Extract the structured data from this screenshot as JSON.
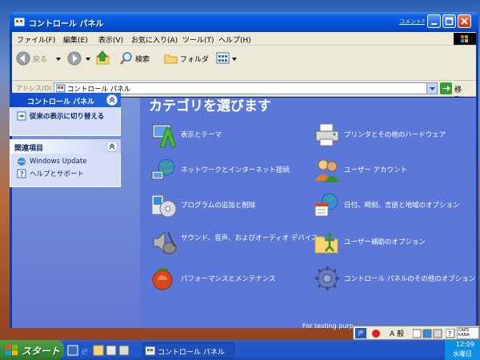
{
  "window": {
    "title": "コントロール パネル",
    "comment_link": "コメント?"
  },
  "menubar": {
    "items": [
      "ファイル(F)",
      "編集(E)",
      "表示(V)",
      "お気に入り(A)",
      "ツール(T)",
      "ヘルプ(H)"
    ]
  },
  "toolbar": {
    "back": "戻る",
    "search": "検索",
    "folders": "フォルダ"
  },
  "addressbar": {
    "label": "アドレス(D)",
    "value": "コントロール パネル",
    "go": "移動"
  },
  "leftpane": {
    "panel1": {
      "title": "コントロール パネル",
      "link": "従来の表示に切り替える"
    },
    "panel2": {
      "title": "関連項目",
      "links": [
        "Windows Update",
        "ヘルプとサポート"
      ]
    }
  },
  "main": {
    "heading": "カテゴリを選びます",
    "categories": [
      {
        "label": "表示とテーマ",
        "icon": "display-themes-icon"
      },
      {
        "label": "プリンタとその他のハードウェア",
        "icon": "printer-icon"
      },
      {
        "label": "ネットワークとインターネット接続",
        "icon": "network-icon"
      },
      {
        "label": "ユーザー アカウント",
        "icon": "users-icon"
      },
      {
        "label": "プログラムの追加と削除",
        "icon": "add-remove-programs-icon"
      },
      {
        "label": "日付、時刻、言語と地域のオプション",
        "icon": "date-time-icon"
      },
      {
        "label": "サウンド、音声、およびオーディオ デバイス",
        "icon": "sound-icon"
      },
      {
        "label": "ユーザー補助のオプション",
        "icon": "accessibility-icon"
      },
      {
        "label": "パフォーマンスとメンテナンス",
        "icon": "performance-icon"
      },
      {
        "label": "コントロール パネルのその他のオプション",
        "icon": "other-options-icon"
      }
    ]
  },
  "testing_text": "For testing purp",
  "ime": {
    "jp": "JP",
    "mode": "A 般",
    "caps": "CAPS\nKANA"
  },
  "taskbar": {
    "start": "スタート",
    "task": "コントロール パネル",
    "time": "12:09",
    "day": "水曜日"
  }
}
